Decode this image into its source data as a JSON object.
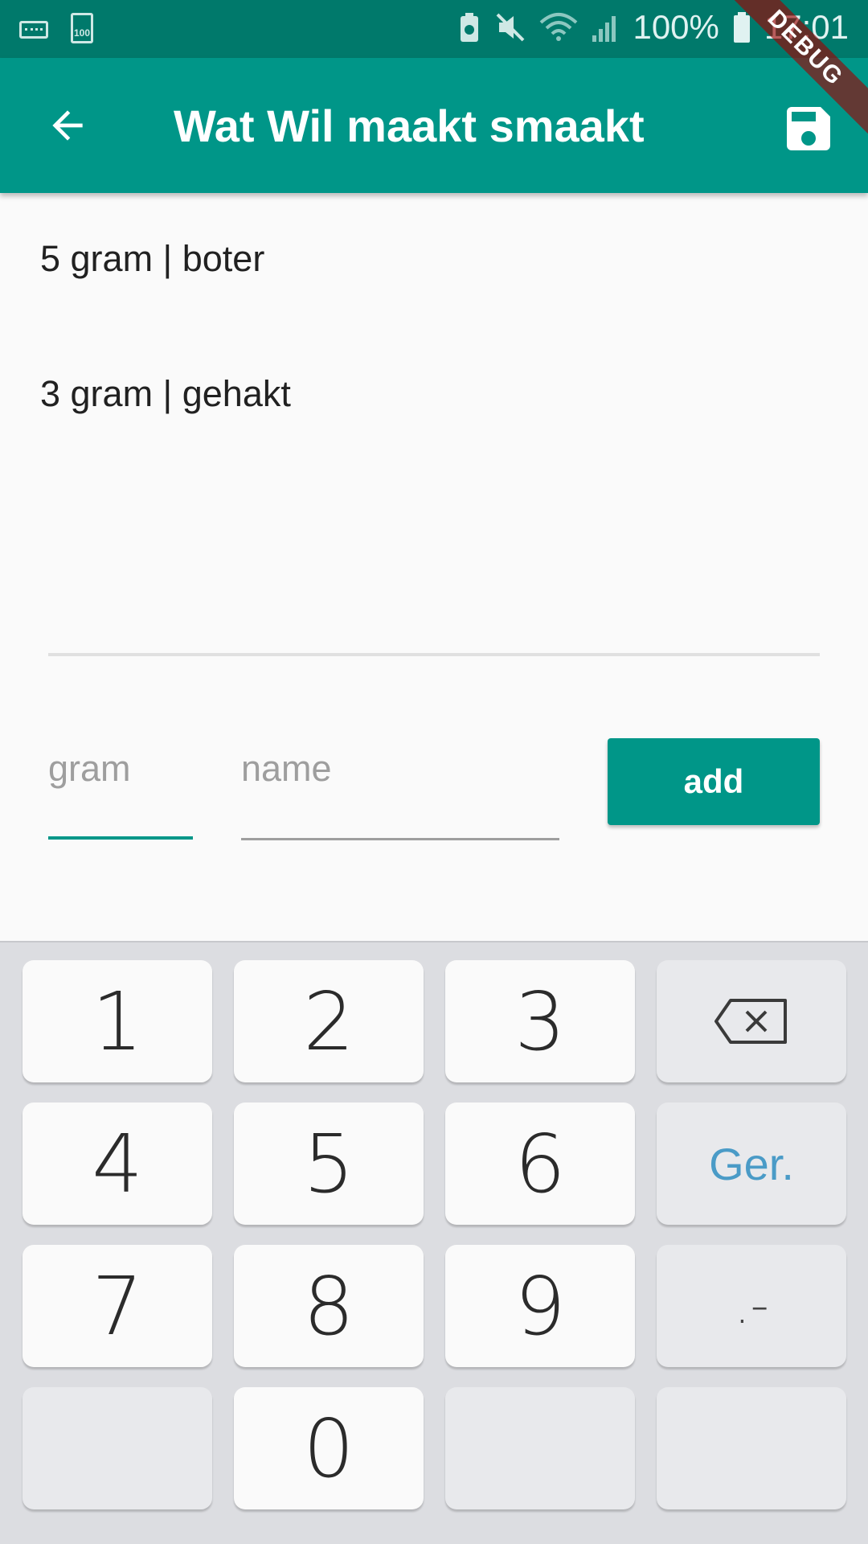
{
  "status_bar": {
    "battery_percent": "100%",
    "time": "17:01",
    "battery_badge": "100"
  },
  "app_bar": {
    "title": "Wat Wil maakt smaakt",
    "debug_label": "DEBUG"
  },
  "ingredients": [
    {
      "text": "5 gram | boter"
    },
    {
      "text": "3 gram | gehakt"
    }
  ],
  "form": {
    "gram_placeholder": "gram",
    "name_placeholder": "name",
    "add_label": "add"
  },
  "keyboard": {
    "keys": [
      "1",
      "2",
      "3",
      "4",
      "5",
      "6",
      "7",
      "8",
      "9",
      "0"
    ],
    "ger_label": "Ger.",
    "dot_label": ".-"
  },
  "colors": {
    "primary": "#009688",
    "primary_dark": "#00796b",
    "accent_key": "#4a9bc7"
  }
}
